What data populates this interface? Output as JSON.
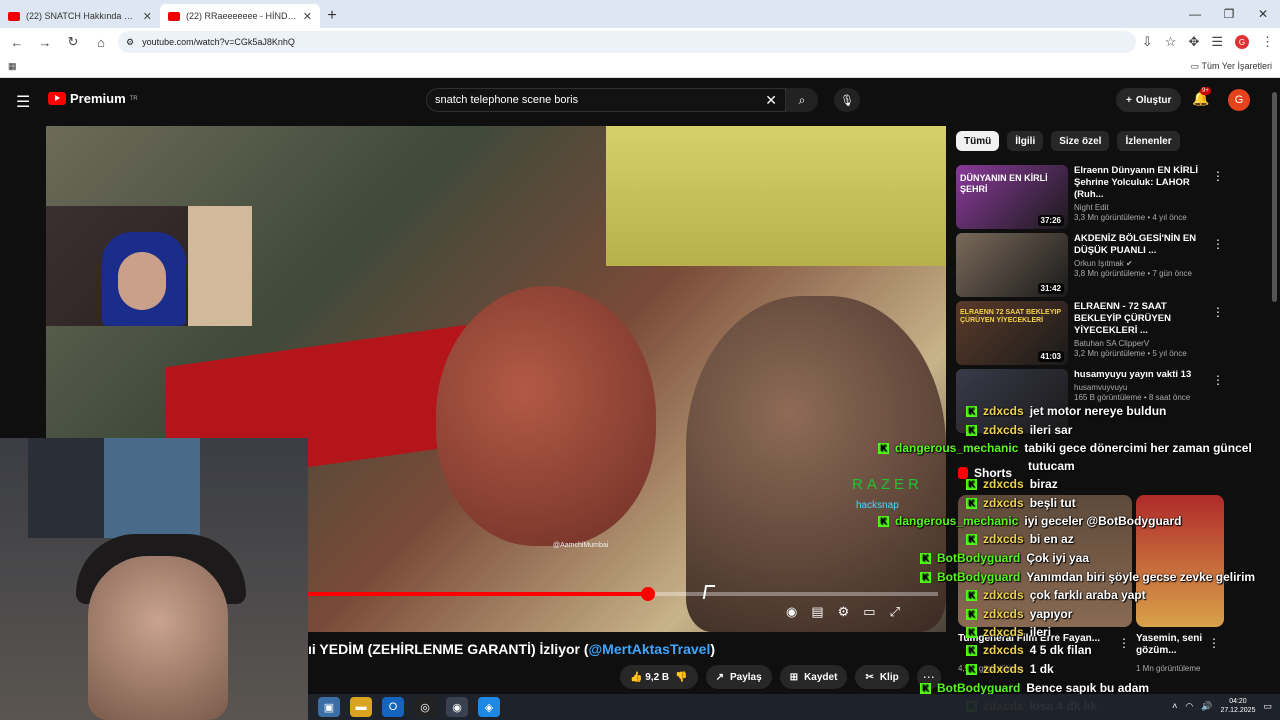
{
  "browser": {
    "tabs": [
      {
        "title": "(22) SNATCH Hakkında 19 Harika..."
      },
      {
        "title": "(22) RRaeeeeeee - HİNDİSTAN..."
      }
    ],
    "url": "youtube.com/watch?v=CGk5aJ8KnhQ",
    "all_bookmarks_label": "Tüm Yer İşaretleri"
  },
  "youtube": {
    "logo_text": "Premium",
    "logo_sup": "TR",
    "search_value": "snatch telephone scene boris",
    "create_label": "Oluştur",
    "notif_badge": "9+",
    "avatar_letter": "G"
  },
  "player": {
    "watermark": "@AamchiMumbai",
    "sponsor": "RAZER",
    "sponsor_sub": "hacksnap",
    "progress": 0.54
  },
  "video": {
    "title_text": "ıi YEDİM (ZEHİRLENME GARANTİ) İzliyor (",
    "title_mention": "@MertAktasTravel",
    "title_end": ")",
    "likes": "9,2 B",
    "share_label": "Paylaş",
    "save_label": "Kaydet",
    "clip_label": "Klip"
  },
  "filters": [
    "Tümü",
    "İlgili",
    "Size özel",
    "İzlenenler"
  ],
  "recommendations": [
    {
      "title": "Elraenn Dünyanın EN KİRLİ Şehrine Yolculuk: LAHOR (Ruh...",
      "channel": "Night Edit",
      "stats": "3,3 Mn görüntüleme • 4 yıl önce",
      "duration": "37:26",
      "thumb_text": "DÜNYANIN EN KİRLİ ŞEHRİ",
      "thumb_color": "#8a3a9a"
    },
    {
      "title": "AKDENİZ BÖLGESİ'NİN EN DÜŞÜK PUANLI ...",
      "channel": "Orkun Işıtmak",
      "stats": "3,8 Mn görüntüleme • 7 gün önce",
      "duration": "31:42",
      "thumb_text": "",
      "thumb_color": "#7a6a5a"
    },
    {
      "title": "ELRAENN - 72 SAAT BEKLEYİP ÇÜRÜYEN YİYECEKLERİ ...",
      "channel": "Batuhan SA ClipperV",
      "stats": "3,2 Mn görüntüleme • 5 yıl önce",
      "duration": "41:03",
      "thumb_text": "ELRAENN 72 SAAT BEKLEYIP ÇÜRÜYEN YİYECEKLERİ",
      "thumb_color": "#5a3a2a"
    },
    {
      "title": "husamyuyu yayın vakti 13",
      "channel": "husamvuyvuyu",
      "stats": "165 B görüntüleme • 8 saat önce",
      "duration": "",
      "thumb_text": "",
      "thumb_color": "#3a3a4a"
    }
  ],
  "shorts": {
    "heading": "Shorts",
    "items": [
      {
        "title": "Tumgeneral Film Erre Fayan...",
        "meta": "4,5 B görüntüleme"
      },
      {
        "title": "Yasemin, seni gözüm...",
        "meta": "1 Mn görüntüleme"
      }
    ]
  },
  "chat": [
    {
      "user": "zdxcds",
      "text": "jet motor nereye buldun",
      "color": "#f0d24a"
    },
    {
      "user": "zdxcds",
      "text": "ileri sar",
      "color": "#f0d24a"
    },
    {
      "user": "dangerous_mechanic",
      "text": "tabiki gece dönercimi her zaman güncel",
      "color": "#53fc18"
    },
    {
      "user": "",
      "text": "tutucam",
      "color": "#53fc18"
    },
    {
      "user": "zdxcds",
      "text": "biraz",
      "color": "#f0d24a"
    },
    {
      "user": "zdxcds",
      "text": "beşli tut",
      "color": "#f0d24a"
    },
    {
      "user": "dangerous_mechanic",
      "text": "iyi geceler @BotBodyguard",
      "color": "#53fc18"
    },
    {
      "user": "zdxcds",
      "text": "bi en az",
      "color": "#f0d24a"
    },
    {
      "user": "BotBodyguard",
      "text": "Çok iyi yaa",
      "color": "#53fc18"
    },
    {
      "user": "BotBodyguard",
      "text": "Yanımdan biri şöyle gecse zevke gelirim",
      "color": "#53fc18"
    },
    {
      "user": "zdxcds",
      "text": "çok farklı araba yapt",
      "color": "#f0d24a"
    },
    {
      "user": "zdxcds",
      "text": "yapıyor",
      "color": "#f0d24a"
    },
    {
      "user": "zdxcds",
      "text": "ileri",
      "color": "#f0d24a"
    },
    {
      "user": "zdxcds",
      "text": "4 5 dk filan",
      "color": "#f0d24a"
    },
    {
      "user": "zdxcds",
      "text": "1 dk",
      "color": "#f0d24a"
    },
    {
      "user": "BotBodyguard",
      "text": "Bence sapık bu adam",
      "color": "#53fc18"
    },
    {
      "user": "zdxcds",
      "text": "kısa 4 dk lık",
      "color": "#f0d24a"
    }
  ],
  "taskbar": {
    "time": "04:20",
    "date": "27.12.2025"
  }
}
